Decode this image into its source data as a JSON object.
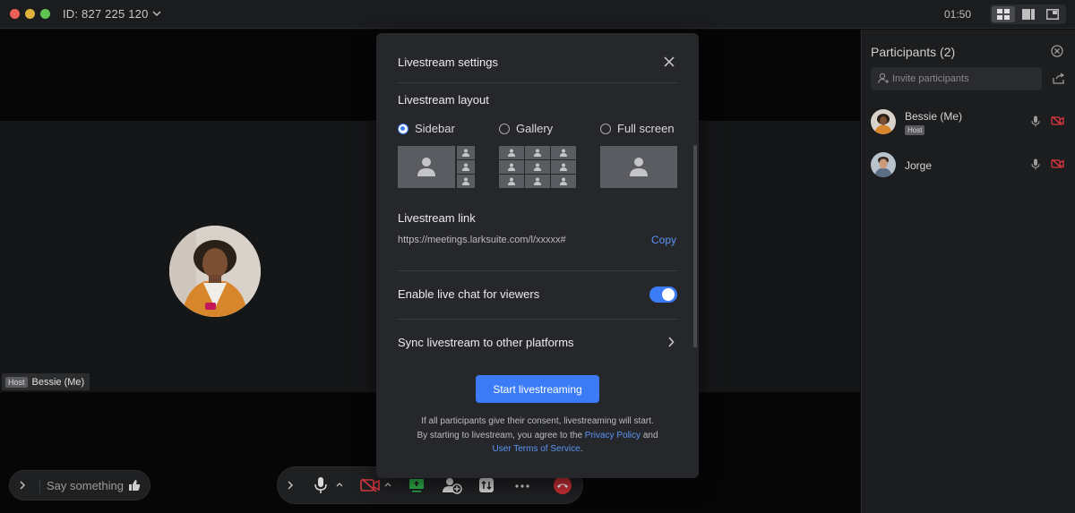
{
  "titlebar": {
    "meeting_id": "ID: 827 225 120",
    "timer": "01:50"
  },
  "stage": {
    "host_badge": "Host",
    "speaker_name": "Bessie (Me)"
  },
  "chat": {
    "placeholder": "Say something"
  },
  "participants": {
    "title": "Participants (2)",
    "invite_placeholder": "Invite participants",
    "list": [
      {
        "name": "Bessie (Me)",
        "badge": "Host"
      },
      {
        "name": "Jorge"
      }
    ]
  },
  "modal": {
    "title": "Livestream settings",
    "layout_heading": "Livestream layout",
    "layout_options": [
      {
        "label": "Sidebar",
        "selected": true
      },
      {
        "label": "Gallery",
        "selected": false
      },
      {
        "label": "Full screen",
        "selected": false
      }
    ],
    "link_heading": "Livestream link",
    "link_url": "https://meetings.larksuite.com/l/xxxxx#",
    "copy_label": "Copy",
    "live_chat_label": "Enable live chat for viewers",
    "live_chat_enabled": true,
    "sync_label": "Sync livestream to other platforms",
    "start_button": "Start livestreaming",
    "consent_line1": "If all participants give their consent, livestreaming will start.",
    "consent_line2_prefix": "By starting to livestream, you agree to the",
    "privacy_link": "Privacy Policy",
    "and_word": "and",
    "terms_link": "User Terms of Service",
    "period": "."
  },
  "colors": {
    "accent": "#3b7bf6",
    "link": "#5a93f5",
    "danger": "#d9373f",
    "share": "#2fb34b"
  }
}
